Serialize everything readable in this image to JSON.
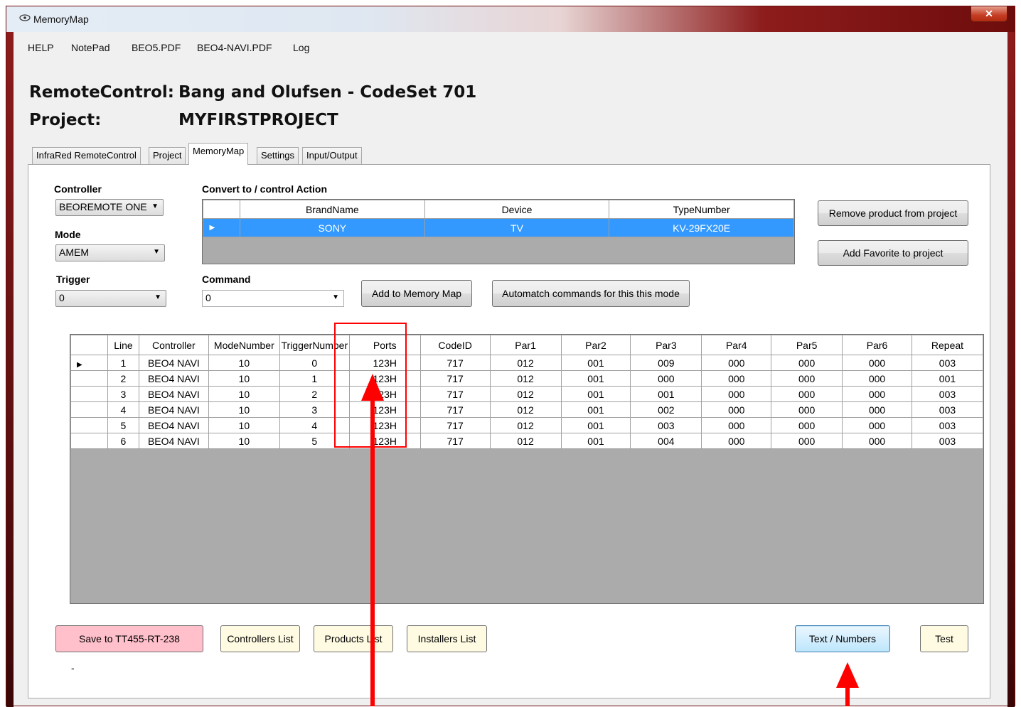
{
  "window": {
    "title": "MemoryMap",
    "close_glyph": "✕"
  },
  "menu": [
    "HELP",
    "NotePad",
    "BEO5.PDF",
    "BEO4-NAVI.PDF",
    "Log"
  ],
  "header": {
    "remote_label": "RemoteControl:",
    "remote_value": "Bang and Olufsen - CodeSet 701",
    "project_label": "Project:",
    "project_value": "MYFIRSTPROJECT"
  },
  "tabs": [
    "InfraRed RemoteControl",
    "Project",
    "MemoryMap",
    "Settings",
    "Input/Output"
  ],
  "active_tab": "MemoryMap",
  "form": {
    "controller_label": "Controller",
    "controller_value": "BEOREMOTE ONE",
    "mode_label": "Mode",
    "mode_value": "AMEM",
    "trigger_label": "Trigger",
    "trigger_value": "0",
    "convert_label": "Convert to / control Action",
    "command_label": "Command",
    "command_value": "0"
  },
  "convert_grid": {
    "columns": [
      "BrandName",
      "Device",
      "TypeNumber"
    ],
    "rows": [
      [
        "SONY",
        "TV",
        "KV-29FX20E"
      ]
    ]
  },
  "buttons": {
    "remove_product": "Remove product from project",
    "add_favorite": "Add Favorite to project",
    "add_to_memory_map": "Add to Memory Map",
    "automatch": "Automatch commands for this this mode",
    "save": "Save to TT455-RT-238",
    "controllers_list": "Controllers List",
    "products_list": "Products List",
    "installers_list": "Installers List",
    "text_numbers": "Text / Numbers",
    "test": "Test"
  },
  "memory_grid": {
    "columns": [
      "Line",
      "Controller",
      "ModeNumber",
      "TriggerNumber",
      "Ports",
      "CodeID",
      "Par1",
      "Par2",
      "Par3",
      "Par4",
      "Par5",
      "Par6",
      "Repeat"
    ],
    "rows": [
      [
        "1",
        "BEO4 NAVI",
        "10",
        "0",
        "123H",
        "717",
        "012",
        "001",
        "009",
        "000",
        "000",
        "000",
        "003"
      ],
      [
        "2",
        "BEO4 NAVI",
        "10",
        "1",
        "123H",
        "717",
        "012",
        "001",
        "000",
        "000",
        "000",
        "000",
        "001"
      ],
      [
        "3",
        "BEO4 NAVI",
        "10",
        "2",
        "123H",
        "717",
        "012",
        "001",
        "001",
        "000",
        "000",
        "000",
        "003"
      ],
      [
        "4",
        "BEO4 NAVI",
        "10",
        "3",
        "123H",
        "717",
        "012",
        "001",
        "002",
        "000",
        "000",
        "000",
        "003"
      ],
      [
        "5",
        "BEO4 NAVI",
        "10",
        "4",
        "123H",
        "717",
        "012",
        "001",
        "003",
        "000",
        "000",
        "000",
        "003"
      ],
      [
        "6",
        "BEO4 NAVI",
        "10",
        "5",
        "123H",
        "717",
        "012",
        "001",
        "004",
        "000",
        "000",
        "000",
        "003"
      ]
    ]
  },
  "status_text": "-",
  "colors": {
    "selection": "#3399ff",
    "annotation": "#ff0000",
    "save_button": "#ffc0cb",
    "list_buttons": "#fffbe2"
  }
}
